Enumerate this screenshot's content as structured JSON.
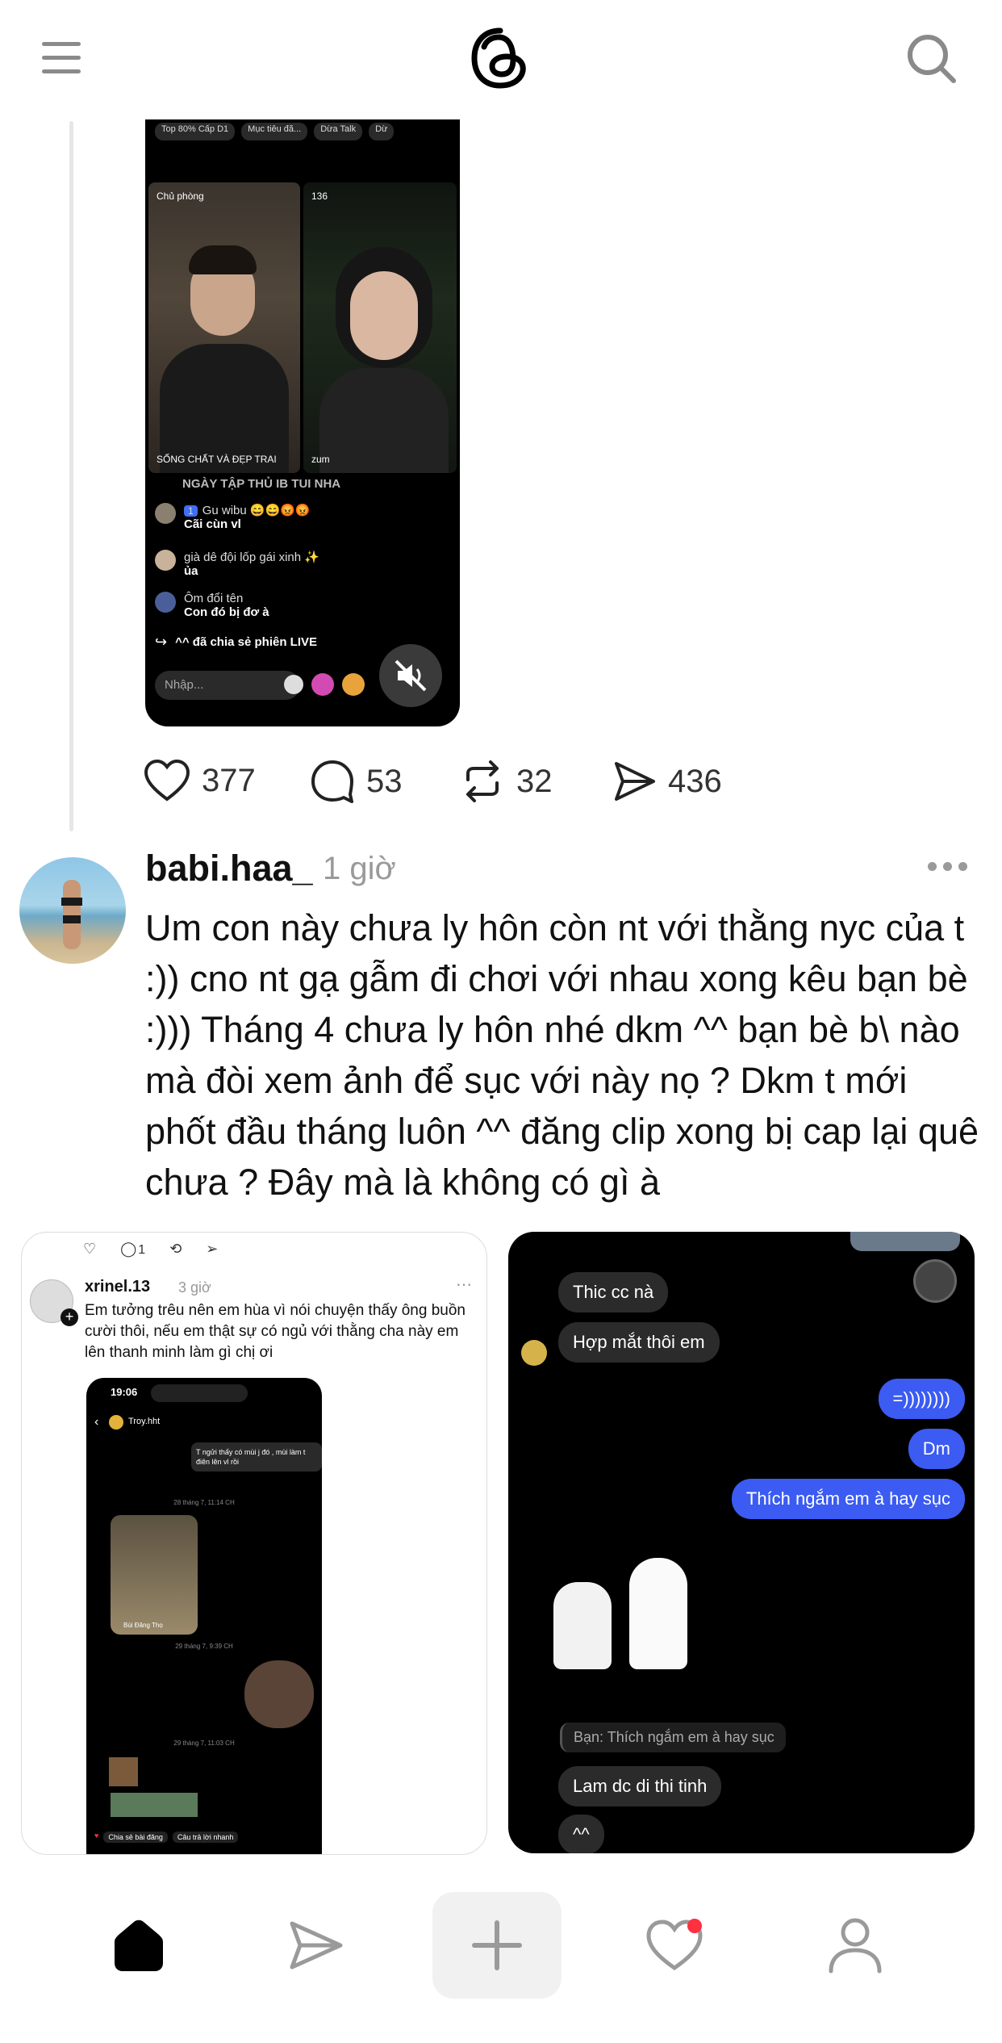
{
  "header": {
    "menu_icon": "menu-icon",
    "logo_icon": "threads-logo-icon",
    "search_icon": "search-icon"
  },
  "live_screenshot": {
    "top_pills": [
      "Top 80% Cấp D1",
      "Mục tiêu đã...",
      "Dừa Talk",
      "Dừ"
    ],
    "host_label": "Chủ phòng",
    "viewer_count": "136",
    "host_caption": "SỐNG CHẤT VÀ ĐẸP TRAI",
    "guest_caption": "zum",
    "banner": "NGÀY TẬP THỦ IB TUI NHA",
    "comments": [
      {
        "name": "Gu wibu 😄😄😡😡",
        "badge": "1",
        "message": "Cãi cùn vl"
      },
      {
        "name": "già dê đội lốp gái xinh ✨",
        "badge": "",
        "message": "ủa"
      },
      {
        "name": "Ôm đổi tên",
        "badge": "",
        "message": "Con đó bị đơ à"
      }
    ],
    "share_notice": "^^ đã chia sẻ phiên LIVE",
    "input_placeholder": "Nhập..."
  },
  "stats": {
    "likes": "377",
    "comments": "53",
    "reposts": "32",
    "shares": "436"
  },
  "post": {
    "username": "babi.haa_",
    "time": "1 giờ",
    "more_icon": "more-icon",
    "text": "Um con này chưa ly hôn còn nt với thằng nyc của t :)) cno nt gạ gẫm đi chơi với nhau xong kêu bạn bè :))) Tháng 4 chưa ly hôn nhé dkm ^^ bạn bè b\\ nào mà đòi xem ảnh để sục với này nọ ? Dkm t mới phốt đầu tháng luôn ^^ đăng clip xong bị cap lại quê chưa ? Đây mà là không có gì à"
  },
  "attachment1": {
    "comment_count": "1",
    "username": "xrinel.13",
    "time": "3 giờ",
    "text": "Em tưởng trêu nên em hùa vì nói chuyện thấy ông buồn cười thôi, nếu em thật sự có ngủ với thằng cha này em lên thanh minh làm gì chị ơi",
    "phone_time": "19:06",
    "chat_name": "Troy.hht",
    "chat_preview": "T ngửi thấy có mùi j đó , mùi làm t điên lên vl rồi",
    "date1": "28 tháng 7, 11:14 CH",
    "media_caption": "Bùi Đăng Thọ",
    "date2": "29 tháng 7, 9:39 CH",
    "date3": "29 tháng 7, 11:03 CH",
    "bottom_chips": [
      "Chia sẻ bài đăng",
      "Câu trả lời nhanh"
    ]
  },
  "attachment2": {
    "left_bubbles": [
      "Thic cc nà",
      "Hợp mắt thôi em"
    ],
    "right_bubbles": [
      "=))))))))",
      "Dm",
      "Thích ngắm em à hay sục"
    ],
    "reply_quote": "Bạn: Thích ngắm em à hay sục",
    "reply1": "Lam dc di thi tinh",
    "reply2": "^^"
  },
  "nav": {
    "home_icon": "home-icon",
    "send_icon": "send-icon",
    "create_icon": "plus-icon",
    "activity_icon": "heart-icon",
    "profile_icon": "profile-icon",
    "accent": "#ff3040"
  }
}
